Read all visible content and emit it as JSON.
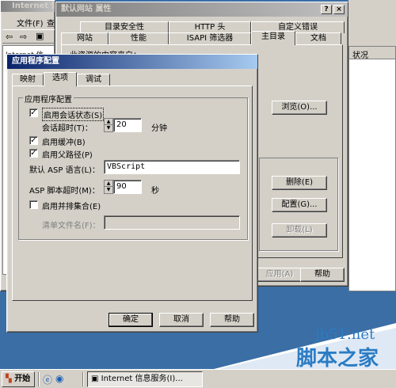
{
  "main_window": {
    "title": "Internet 信",
    "menu_file": "文件(F)",
    "menu_view": "查",
    "tree_item": "Internet 信",
    "status_col": "状况"
  },
  "props": {
    "title": "默认网站 属性",
    "help_btn": "?",
    "close_btn": "×",
    "tabs_back": [
      "目录安全性",
      "HTTP 头",
      "自定义错误"
    ],
    "tabs_front": [
      "网站",
      "性能",
      "ISAPI 筛选器",
      "主目录",
      "文档"
    ],
    "content_source": "此资源的内容来自：",
    "browse_btn": "浏览(O)...",
    "remove_btn": "删除(E)",
    "config_btn": "配置(G)...",
    "unload_btn": "卸载(L)",
    "apply_btn": "应用(A)",
    "help_button": "帮助"
  },
  "dialog": {
    "title": "应用程序配置",
    "tabs": [
      "映射",
      "选项",
      "调试"
    ],
    "group_title": "应用程序配置",
    "session_state_label": "启用会话状态(S)",
    "session_state_checked": true,
    "session_timeout_label": "会话超时(T)：",
    "session_timeout_value": "20",
    "session_timeout_unit": "分钟",
    "buffering_label": "启用缓冲(B)",
    "buffering_checked": true,
    "parent_paths_label": "启用父路径(P)",
    "parent_paths_checked": true,
    "asp_language_label": "默认 ASP 语言(L)：",
    "asp_language_value": "VBScript",
    "asp_timeout_label": "ASP 脚本超时(M)：",
    "asp_timeout_value": "90",
    "asp_timeout_unit": "秒",
    "side_by_side_label": "启用并排集合(E)",
    "side_by_side_checked": false,
    "manifest_label": "清单文件名(F)：",
    "manifest_value": "",
    "ok_btn": "确定",
    "cancel_btn": "取消",
    "help_btn": "帮助"
  },
  "taskbar": {
    "start_label": "开始",
    "task_label": "Internet 信息服务(I)..."
  },
  "watermark": {
    "domain": "jb51.net",
    "brand": "脚本之家"
  },
  "colors": {
    "desktop": "#3a6ea5",
    "active_title": "#0a246a",
    "face": "#d4d0c8"
  }
}
